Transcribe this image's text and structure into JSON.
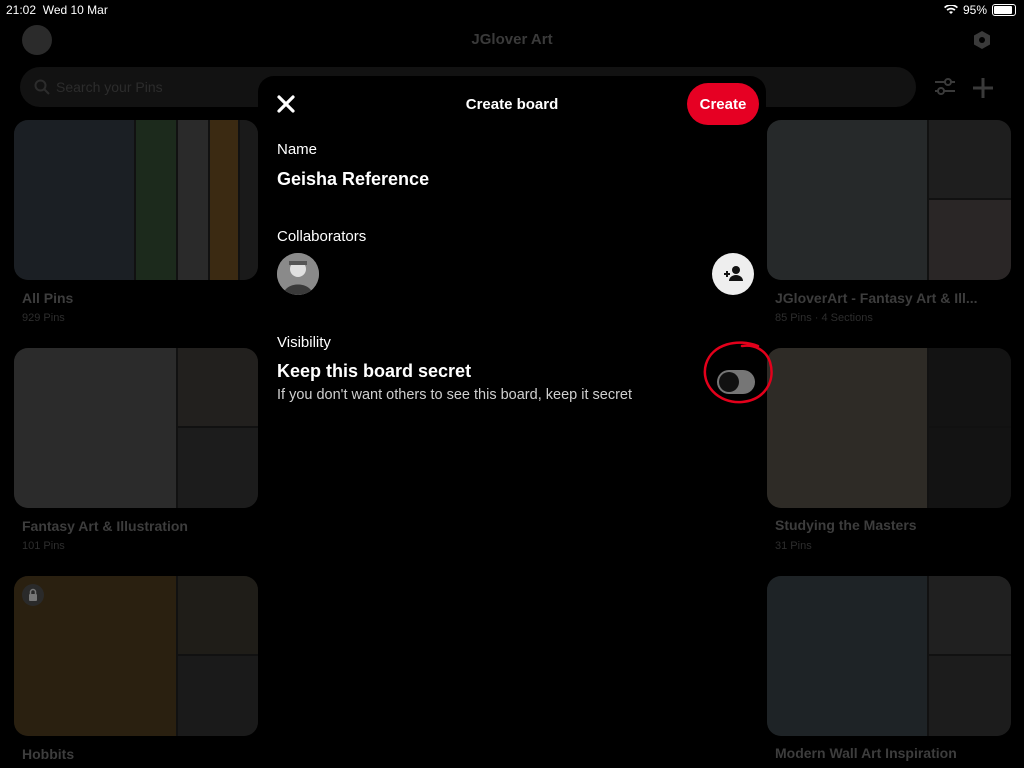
{
  "status_bar": {
    "time": "21:02",
    "date": "Wed 10 Mar",
    "battery": "95%"
  },
  "app": {
    "title": "JGlover Art",
    "search_placeholder": "Search your Pins",
    "boards": [
      {
        "title": "All Pins",
        "subtitle": "929 Pins"
      },
      {
        "title": "JGloverArt - Fantasy Art & Ill...",
        "subtitle": "85 Pins · 4 Sections"
      },
      {
        "title": "Fantasy Art & Illustration",
        "subtitle": "101 Pins"
      },
      {
        "title": "Studying the Masters",
        "subtitle": "31 Pins"
      },
      {
        "title": "Hobbits",
        "subtitle": ""
      },
      {
        "title": "Modern Wall Art Inspiration",
        "subtitle": ""
      }
    ]
  },
  "modal": {
    "title": "Create board",
    "create_label": "Create",
    "name_label": "Name",
    "name_value": "Geisha Reference",
    "collaborators_label": "Collaborators",
    "visibility_label": "Visibility",
    "secret_title": "Keep this board secret",
    "secret_desc": "If you don't want others to see this board, keep it secret",
    "secret_enabled": false
  },
  "colors": {
    "accent": "#e60023",
    "annotation": "#e3001b",
    "toggle_off": "#767676"
  },
  "icons": [
    "close-icon",
    "add-person-icon",
    "search-icon",
    "filter-icon",
    "plus-icon",
    "hexagon-settings-icon",
    "lock-icon",
    "wifi-icon",
    "battery-icon"
  ]
}
